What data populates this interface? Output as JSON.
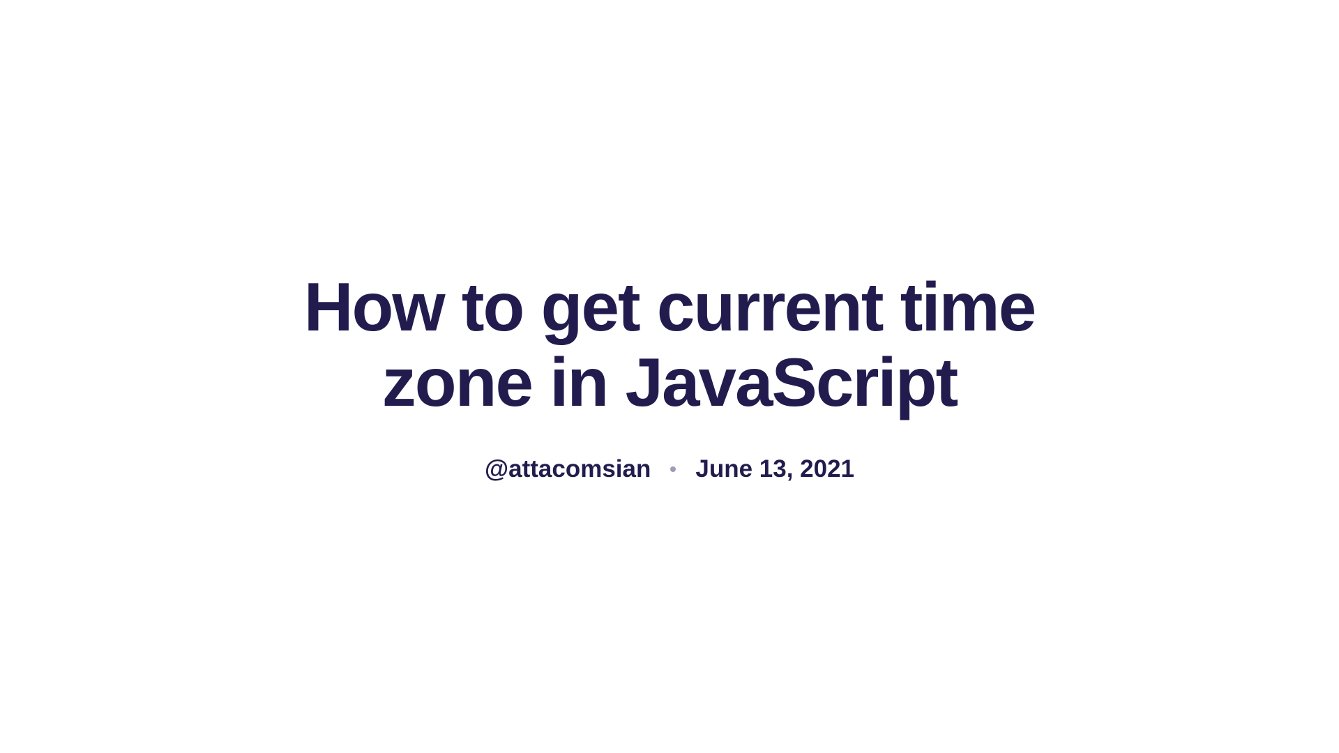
{
  "title": "How to get current time zone in JavaScript",
  "author": "@attacomsian",
  "date": "June 13, 2021"
}
